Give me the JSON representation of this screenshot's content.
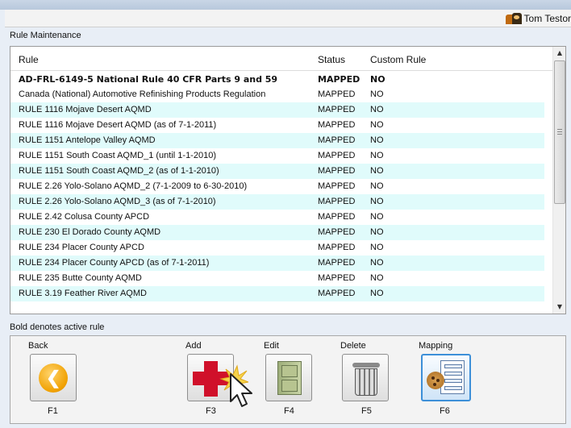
{
  "header": {
    "user_name": "Tom Testor"
  },
  "section_title": "Rule Maintenance",
  "grid": {
    "columns": [
      "Rule",
      "Status",
      "Custom Rule"
    ],
    "rows": [
      {
        "rule": "AD-FRL-6149-5 National Rule 40 CFR Parts 9 and 59",
        "status": "MAPPED",
        "custom": "NO",
        "active": true
      },
      {
        "rule": "Canada (National) Automotive Refinishing Products Regulation",
        "status": "MAPPED",
        "custom": "NO",
        "active": false
      },
      {
        "rule": "RULE 1116 Mojave Desert AQMD",
        "status": "MAPPED",
        "custom": "NO",
        "active": false
      },
      {
        "rule": "RULE 1116 Mojave Desert AQMD (as of 7-1-2011)",
        "status": "MAPPED",
        "custom": "NO",
        "active": false
      },
      {
        "rule": "RULE 1151 Antelope Valley AQMD",
        "status": "MAPPED",
        "custom": "NO",
        "active": false
      },
      {
        "rule": "RULE 1151 South Coast AQMD_1 (until 1-1-2010)",
        "status": "MAPPED",
        "custom": "NO",
        "active": false
      },
      {
        "rule": "RULE 1151 South Coast AQMD_2 (as of 1-1-2010)",
        "status": "MAPPED",
        "custom": "NO",
        "active": false
      },
      {
        "rule": "RULE 2.26 Yolo-Solano AQMD_2 (7-1-2009 to 6-30-2010)",
        "status": "MAPPED",
        "custom": "NO",
        "active": false
      },
      {
        "rule": "RULE 2.26 Yolo-Solano AQMD_3 (as of 7-1-2010)",
        "status": "MAPPED",
        "custom": "NO",
        "active": false
      },
      {
        "rule": "RULE 2.42 Colusa County APCD",
        "status": "MAPPED",
        "custom": "NO",
        "active": false
      },
      {
        "rule": "RULE 230 El Dorado County AQMD",
        "status": "MAPPED",
        "custom": "NO",
        "active": false
      },
      {
        "rule": "RULE 234 Placer County APCD",
        "status": "MAPPED",
        "custom": "NO",
        "active": false
      },
      {
        "rule": "RULE 234 Placer County APCD (as of 7-1-2011)",
        "status": "MAPPED",
        "custom": "NO",
        "active": false
      },
      {
        "rule": "RULE 235 Butte County AQMD",
        "status": "MAPPED",
        "custom": "NO",
        "active": false
      },
      {
        "rule": "RULE 3.19 Feather River AQMD",
        "status": "MAPPED",
        "custom": "NO",
        "active": false
      }
    ]
  },
  "footer_note": "Bold denotes active rule",
  "toolbar": {
    "buttons": [
      {
        "label": "Back",
        "key": "F1",
        "icon": "back-arrow-icon"
      },
      {
        "label": "Add",
        "key": "F3",
        "icon": "red-cross-add-icon"
      },
      {
        "label": "Edit",
        "key": "F4",
        "icon": "file-cabinet-icon"
      },
      {
        "label": "Delete",
        "key": "F5",
        "icon": "trash-can-icon"
      },
      {
        "label": "Mapping",
        "key": "F6",
        "icon": "mapping-document-icon"
      }
    ]
  },
  "colors": {
    "row_alt": "#e0fbfb",
    "mapping_focus": "#3c8fd8",
    "add_cross": "#d0102a",
    "back_circle": "#f0a000"
  }
}
